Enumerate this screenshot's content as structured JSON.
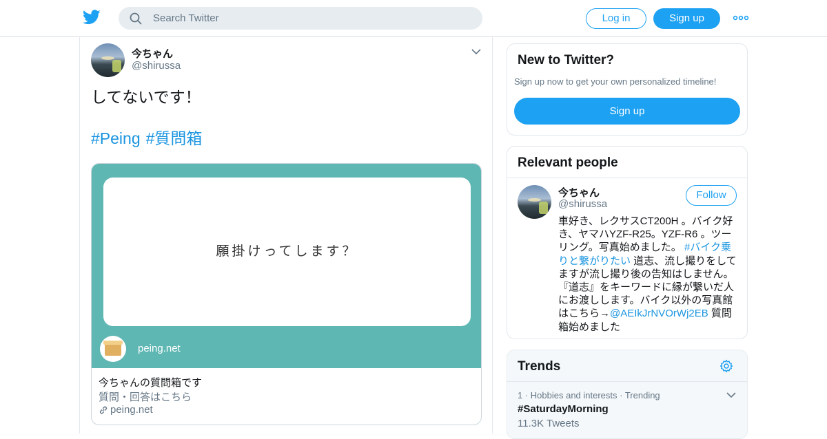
{
  "colors": {
    "accent": "#1da1f2",
    "link": "#1b95e0",
    "card_bg": "#5fb7b4",
    "muted": "#657786"
  },
  "header": {
    "logo_icon": "twitter-bird-icon",
    "search_placeholder": "Search Twitter",
    "search_icon": "search-icon",
    "login_label": "Log in",
    "signup_label": "Sign up",
    "more_icon": "more-dots-icon"
  },
  "tweet": {
    "author_name": "今ちゃん",
    "author_handle": "@shirussa",
    "text": "してないです！",
    "hashtags": [
      "#Peing",
      "#質問箱"
    ],
    "card": {
      "image_text": "願掛けってします？",
      "site_label": "peing.net",
      "title": "今ちゃんの質問箱です",
      "description": "質問・回答はこちら",
      "domain": "peing.net"
    }
  },
  "new_to_twitter": {
    "title": "New to Twitter?",
    "subtitle": "Sign up now to get your own personalized timeline!",
    "signup_label": "Sign up"
  },
  "relevant_people": {
    "title": "Relevant people",
    "person": {
      "name": "今ちゃん",
      "handle": "@shirussa",
      "follow_label": "Follow",
      "bio_part1": "車好き、レクサスCT200H 。バイク好き、ヤマハYZF-R25。YZF-R6 。ツーリング。写真始めました。",
      "bio_link1": "#バイク乗りと繋がりたい",
      "bio_part2": " 道志、流し撮りをしてますが流し撮り後の告知はしません。『道志』をキーワードに縁が繋いだ人にお渡しします。バイク以外の写真館はこちら→",
      "bio_link2": "@AEIkJrNVOrWj2EB",
      "bio_part3": " 質問箱始めました"
    }
  },
  "trends": {
    "title": "Trends",
    "items": [
      {
        "meta": "1 · Hobbies and interests · Trending",
        "tag": "#SaturdayMorning",
        "count": "11.3K Tweets"
      }
    ]
  }
}
